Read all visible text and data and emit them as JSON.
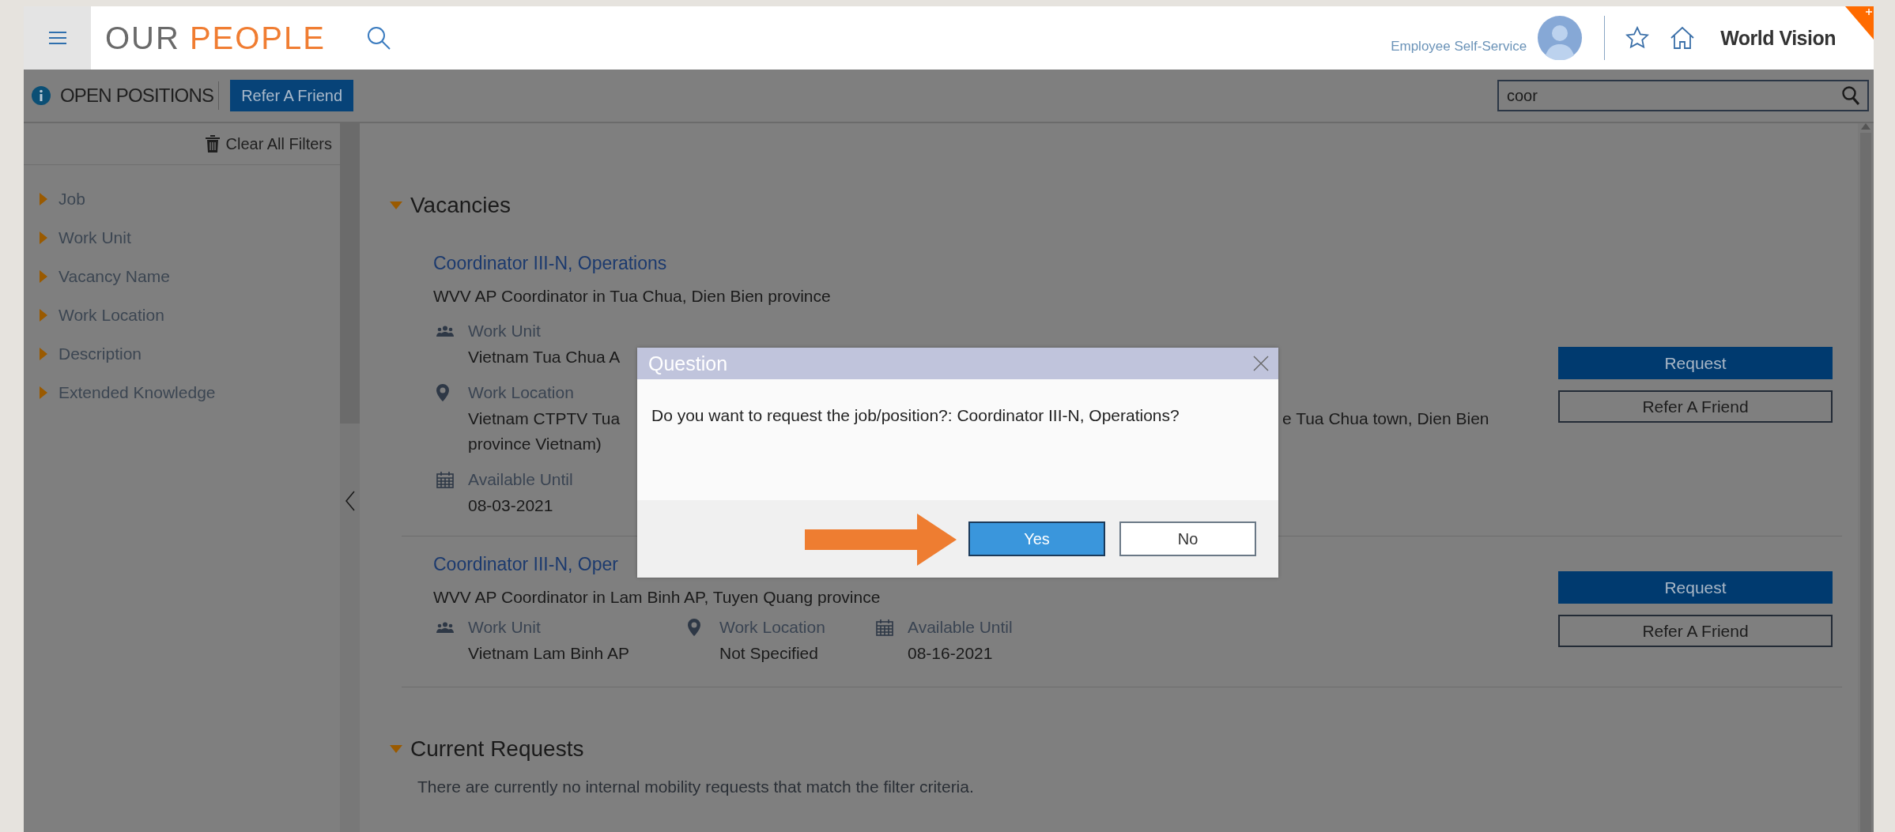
{
  "header": {
    "logo_first": "OUR",
    "logo_second": "PEOPLE",
    "portal_label": "Employee Self-Service",
    "brand": "World Vision"
  },
  "toolbar": {
    "title": "OPEN POSITIONS",
    "refer_button": "Refer A Friend",
    "search": {
      "value": "coor"
    }
  },
  "sidebar": {
    "clear_filters": "Clear All Filters",
    "filters": [
      {
        "label": "Job",
        "expanded": false
      },
      {
        "label": "Work Unit",
        "expanded": false
      },
      {
        "label": "Vacancy Name",
        "expanded": false
      },
      {
        "label": "Work Location",
        "expanded": false
      },
      {
        "label": "Description",
        "expanded": false
      },
      {
        "label": "Extended Knowledge",
        "expanded": false
      }
    ]
  },
  "vacancies": {
    "heading": "Vacancies",
    "expanded": true,
    "items": [
      {
        "kind": "stacked",
        "title": "Coordinator III-N, Operations",
        "description": "WVV AP Coordinator in Tua Chua, Dien Bien province",
        "fields": [
          {
            "kind": "work_unit",
            "label": "Work Unit",
            "value_lines": [
              [
                "Vietnam Tua Chua A"
              ]
            ]
          },
          {
            "kind": "work_location",
            "label": "Work Location",
            "value_lines": [
              [
                "Vietnam CTPTV Tua",
                "e Tua Chua town, Dien Bien"
              ],
              [
                "province Vietnam)"
              ]
            ]
          },
          {
            "kind": "available_until",
            "label": "Available Until",
            "value_lines": [
              [
                "08-03-2021"
              ]
            ]
          }
        ],
        "buttons": [
          "Request",
          "Refer A Friend"
        ]
      },
      {
        "kind": "inline",
        "title": "Coordinator III-N, Oper",
        "description": "WVV AP Coordinator in Lam Binh AP, Tuyen Quang province",
        "fields": [
          {
            "kind": "work_unit",
            "label": "Work Unit",
            "value_lines": [
              [
                "Vietnam Lam Binh AP"
              ]
            ]
          },
          {
            "kind": "work_location",
            "label": "Work Location",
            "value_lines": [
              [
                "Not Specified"
              ]
            ]
          },
          {
            "kind": "available_until",
            "label": "Available Until",
            "value_lines": [
              [
                "08-16-2021"
              ]
            ]
          }
        ],
        "buttons": [
          "Request",
          "Refer A Friend"
        ]
      }
    ]
  },
  "current_requests": {
    "heading": "Current Requests",
    "expanded": true,
    "note": "There are currently no internal mobility requests that match the filter criteria."
  },
  "dialog": {
    "title": "Question",
    "message": "Do you want to request the job/position?: Coordinator III-N, Operations?",
    "buttons": [
      {
        "label": "Yes",
        "kind": "primary"
      },
      {
        "label": "No",
        "kind": "secondary"
      }
    ]
  }
}
